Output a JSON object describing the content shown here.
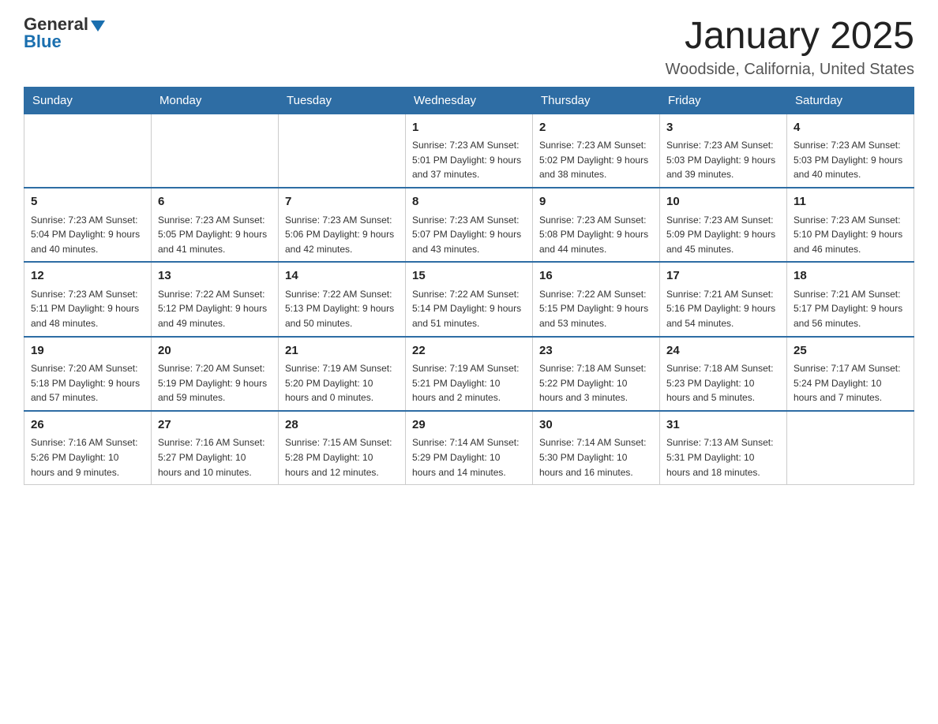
{
  "header": {
    "logo_general": "General",
    "logo_blue": "Blue",
    "title": "January 2025",
    "location": "Woodside, California, United States"
  },
  "days_of_week": [
    "Sunday",
    "Monday",
    "Tuesday",
    "Wednesday",
    "Thursday",
    "Friday",
    "Saturday"
  ],
  "weeks": [
    [
      {
        "day": "",
        "info": ""
      },
      {
        "day": "",
        "info": ""
      },
      {
        "day": "",
        "info": ""
      },
      {
        "day": "1",
        "info": "Sunrise: 7:23 AM\nSunset: 5:01 PM\nDaylight: 9 hours and 37 minutes."
      },
      {
        "day": "2",
        "info": "Sunrise: 7:23 AM\nSunset: 5:02 PM\nDaylight: 9 hours and 38 minutes."
      },
      {
        "day": "3",
        "info": "Sunrise: 7:23 AM\nSunset: 5:03 PM\nDaylight: 9 hours and 39 minutes."
      },
      {
        "day": "4",
        "info": "Sunrise: 7:23 AM\nSunset: 5:03 PM\nDaylight: 9 hours and 40 minutes."
      }
    ],
    [
      {
        "day": "5",
        "info": "Sunrise: 7:23 AM\nSunset: 5:04 PM\nDaylight: 9 hours and 40 minutes."
      },
      {
        "day": "6",
        "info": "Sunrise: 7:23 AM\nSunset: 5:05 PM\nDaylight: 9 hours and 41 minutes."
      },
      {
        "day": "7",
        "info": "Sunrise: 7:23 AM\nSunset: 5:06 PM\nDaylight: 9 hours and 42 minutes."
      },
      {
        "day": "8",
        "info": "Sunrise: 7:23 AM\nSunset: 5:07 PM\nDaylight: 9 hours and 43 minutes."
      },
      {
        "day": "9",
        "info": "Sunrise: 7:23 AM\nSunset: 5:08 PM\nDaylight: 9 hours and 44 minutes."
      },
      {
        "day": "10",
        "info": "Sunrise: 7:23 AM\nSunset: 5:09 PM\nDaylight: 9 hours and 45 minutes."
      },
      {
        "day": "11",
        "info": "Sunrise: 7:23 AM\nSunset: 5:10 PM\nDaylight: 9 hours and 46 minutes."
      }
    ],
    [
      {
        "day": "12",
        "info": "Sunrise: 7:23 AM\nSunset: 5:11 PM\nDaylight: 9 hours and 48 minutes."
      },
      {
        "day": "13",
        "info": "Sunrise: 7:22 AM\nSunset: 5:12 PM\nDaylight: 9 hours and 49 minutes."
      },
      {
        "day": "14",
        "info": "Sunrise: 7:22 AM\nSunset: 5:13 PM\nDaylight: 9 hours and 50 minutes."
      },
      {
        "day": "15",
        "info": "Sunrise: 7:22 AM\nSunset: 5:14 PM\nDaylight: 9 hours and 51 minutes."
      },
      {
        "day": "16",
        "info": "Sunrise: 7:22 AM\nSunset: 5:15 PM\nDaylight: 9 hours and 53 minutes."
      },
      {
        "day": "17",
        "info": "Sunrise: 7:21 AM\nSunset: 5:16 PM\nDaylight: 9 hours and 54 minutes."
      },
      {
        "day": "18",
        "info": "Sunrise: 7:21 AM\nSunset: 5:17 PM\nDaylight: 9 hours and 56 minutes."
      }
    ],
    [
      {
        "day": "19",
        "info": "Sunrise: 7:20 AM\nSunset: 5:18 PM\nDaylight: 9 hours and 57 minutes."
      },
      {
        "day": "20",
        "info": "Sunrise: 7:20 AM\nSunset: 5:19 PM\nDaylight: 9 hours and 59 minutes."
      },
      {
        "day": "21",
        "info": "Sunrise: 7:19 AM\nSunset: 5:20 PM\nDaylight: 10 hours and 0 minutes."
      },
      {
        "day": "22",
        "info": "Sunrise: 7:19 AM\nSunset: 5:21 PM\nDaylight: 10 hours and 2 minutes."
      },
      {
        "day": "23",
        "info": "Sunrise: 7:18 AM\nSunset: 5:22 PM\nDaylight: 10 hours and 3 minutes."
      },
      {
        "day": "24",
        "info": "Sunrise: 7:18 AM\nSunset: 5:23 PM\nDaylight: 10 hours and 5 minutes."
      },
      {
        "day": "25",
        "info": "Sunrise: 7:17 AM\nSunset: 5:24 PM\nDaylight: 10 hours and 7 minutes."
      }
    ],
    [
      {
        "day": "26",
        "info": "Sunrise: 7:16 AM\nSunset: 5:26 PM\nDaylight: 10 hours and 9 minutes."
      },
      {
        "day": "27",
        "info": "Sunrise: 7:16 AM\nSunset: 5:27 PM\nDaylight: 10 hours and 10 minutes."
      },
      {
        "day": "28",
        "info": "Sunrise: 7:15 AM\nSunset: 5:28 PM\nDaylight: 10 hours and 12 minutes."
      },
      {
        "day": "29",
        "info": "Sunrise: 7:14 AM\nSunset: 5:29 PM\nDaylight: 10 hours and 14 minutes."
      },
      {
        "day": "30",
        "info": "Sunrise: 7:14 AM\nSunset: 5:30 PM\nDaylight: 10 hours and 16 minutes."
      },
      {
        "day": "31",
        "info": "Sunrise: 7:13 AM\nSunset: 5:31 PM\nDaylight: 10 hours and 18 minutes."
      },
      {
        "day": "",
        "info": ""
      }
    ]
  ]
}
